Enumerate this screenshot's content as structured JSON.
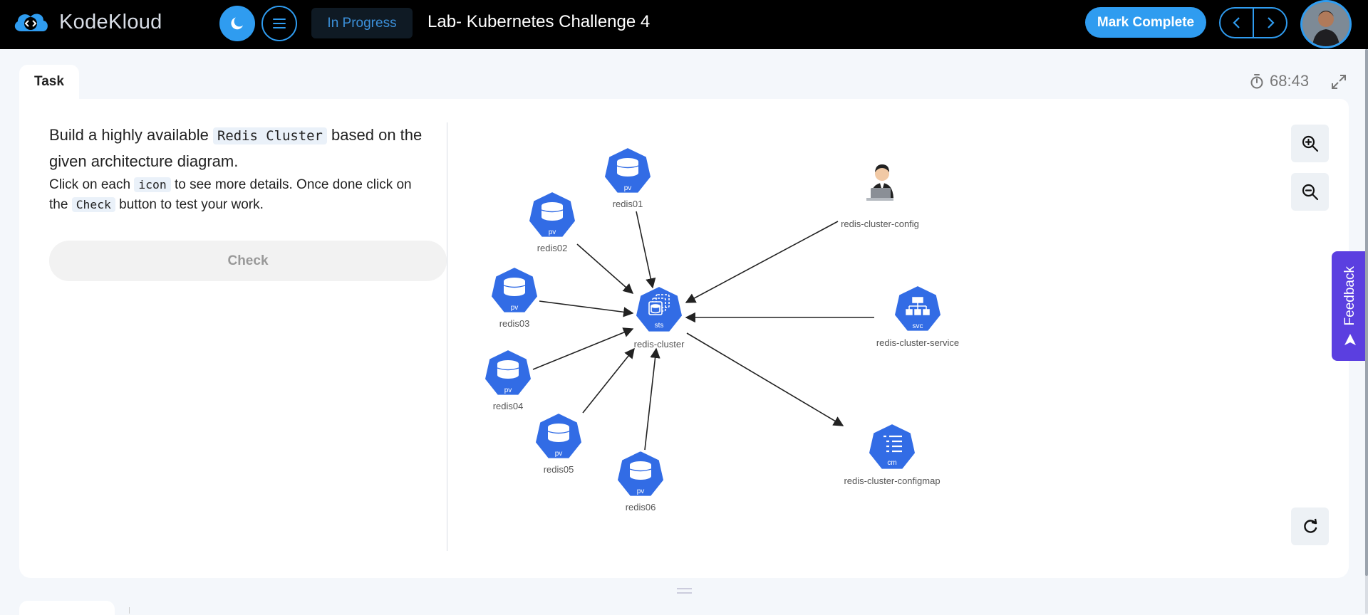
{
  "app": {
    "brand": "KodeKloud"
  },
  "header": {
    "status": "In Progress",
    "lab_title": "Lab- Kubernetes Challenge 4",
    "mark_complete": "Mark Complete"
  },
  "task": {
    "tab_label": "Task",
    "timer": "68:43",
    "instructions": {
      "p1_a": "Build a highly available ",
      "p1_code": "Redis Cluster",
      "p1_b": " based on the given architecture diagram.",
      "p2_a": "Click on each ",
      "p2_code1": "icon",
      "p2_b": " to see more details. Once done click on the ",
      "p2_code2": "Check",
      "p2_c": " button to test your work."
    },
    "check_label": "Check"
  },
  "diagram": {
    "pv_badge": "pv",
    "sts_badge": "sts",
    "svc_badge": "svc",
    "cm_badge": "cm",
    "labels": {
      "redis01": "redis01",
      "redis02": "redis02",
      "redis03": "redis03",
      "redis04": "redis04",
      "redis05": "redis05",
      "redis06": "redis06",
      "cluster": "redis-cluster",
      "config": "redis-cluster-config",
      "service": "redis-cluster-service",
      "configmap": "redis-cluster-configmap"
    }
  },
  "feedback": {
    "label": "Feedback"
  },
  "colors": {
    "accent": "#2f9cf0",
    "k8s_blue": "#326ce5",
    "feedback": "#5b3fe0"
  }
}
